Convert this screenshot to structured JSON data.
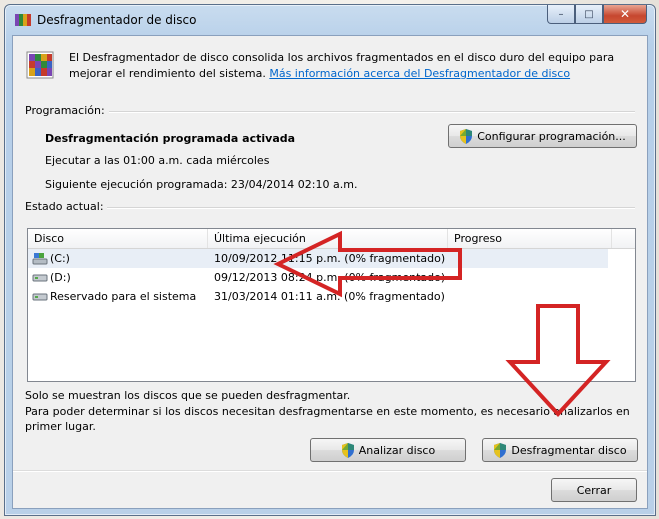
{
  "window": {
    "title": "Desfragmentador de disco",
    "controls": {
      "minimize": "–",
      "maximize": "□",
      "close": "✕"
    }
  },
  "intro": {
    "text": "El Desfragmentador de disco consolida los archivos fragmentados en el disco duro del equipo para mejorar el rendimiento del sistema.",
    "link": "Más información acerca del Desfragmentador de disco"
  },
  "schedule": {
    "label": "Programación:",
    "status": "Desfragmentación programada activada",
    "run": "Ejecutar a las 01:00 a.m. cada miércoles",
    "next": "Siguiente ejecución programada: 23/04/2014 02:10 a.m.",
    "configure_button": "Configurar programación..."
  },
  "current": {
    "label": "Estado actual:",
    "columns": {
      "disk": "Disco",
      "last_run": "Última ejecución",
      "progress": "Progreso"
    },
    "rows": [
      {
        "disk": "(C:)",
        "last_run": "10/09/2012 11:15 p.m. (0% fragmentado)",
        "progress": ""
      },
      {
        "disk": "(D:)",
        "last_run": "09/12/2013 08:24 p.m. (0% fragmentado)",
        "progress": ""
      },
      {
        "disk": "Reservado para el sistema",
        "last_run": "31/03/2014 01:11 a.m. (0% fragmentado)",
        "progress": ""
      }
    ]
  },
  "notes": {
    "line1": "Solo se muestran los discos que se pueden desfragmentar.",
    "line2": "Para poder determinar si los discos necesitan desfragmentarse en este momento, es necesario analizarlos en primer lugar."
  },
  "actions": {
    "analyze": "Analizar disco",
    "defragment": "Desfragmentar disco",
    "close": "Cerrar"
  },
  "icons": {
    "app": "defragmenter-icon",
    "shield": "uac-shield-icon",
    "system_drive": "system-drive-icon",
    "drive": "hard-drive-icon"
  },
  "colors": {
    "link": "#0066cc",
    "annotation_arrow": "#d42424",
    "window_frame": "#b9d0e8"
  }
}
